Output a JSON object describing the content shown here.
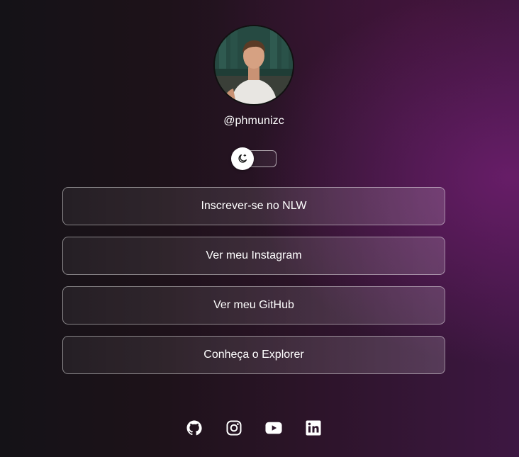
{
  "profile": {
    "username": "@phmunizc"
  },
  "theme_toggle": {
    "icon": "moon-icon"
  },
  "links": [
    {
      "label": "Inscrever-se no NLW"
    },
    {
      "label": "Ver meu Instagram"
    },
    {
      "label": "Ver meu GitHub"
    },
    {
      "label": "Conheça o Explorer"
    }
  ],
  "social": [
    {
      "icon": "github-icon"
    },
    {
      "icon": "instagram-icon"
    },
    {
      "icon": "youtube-icon"
    },
    {
      "icon": "linkedin-icon"
    }
  ],
  "colors": {
    "background_dark": "#141217",
    "background_accent": "#6e1e6e",
    "text": "#ffffff"
  }
}
